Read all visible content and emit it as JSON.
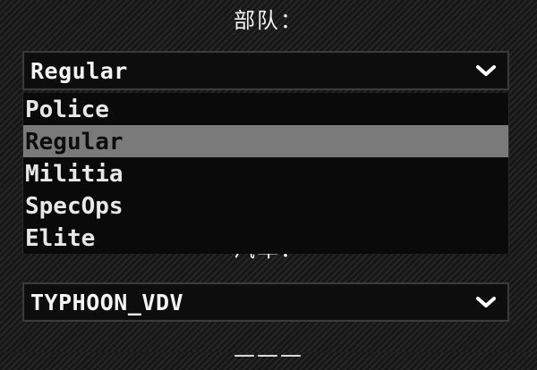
{
  "labels": {
    "unit": "部队：",
    "vehicle": "汽车：",
    "bottom": "———"
  },
  "unit_select": {
    "value": "Regular",
    "icon": "chevron-down-icon",
    "expanded": true,
    "options": [
      {
        "label": "Police",
        "selected": false
      },
      {
        "label": "Regular",
        "selected": true
      },
      {
        "label": "Militia",
        "selected": false
      },
      {
        "label": "SpecOps",
        "selected": false
      },
      {
        "label": "Elite",
        "selected": false
      }
    ]
  },
  "vehicle_select": {
    "value": "TYPHOON_VDV",
    "icon": "chevron-down-icon"
  },
  "colors": {
    "highlight": "#7a7a7a",
    "panel": "#0d0d0d",
    "text": "#f4f4f4"
  }
}
